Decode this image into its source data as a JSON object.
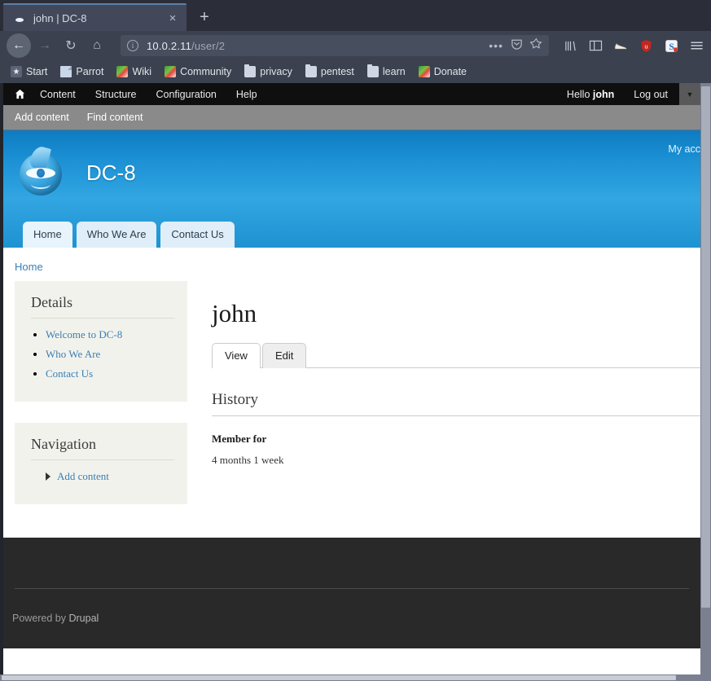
{
  "browser": {
    "tab": {
      "title": "john | DC-8",
      "favicon": "drupal-drop-icon",
      "close": "×"
    },
    "new_tab": "+",
    "nav": {
      "back": "←",
      "forward": "→",
      "reload": "↻",
      "home": "⌂"
    },
    "url": {
      "host": "10.0.2.11",
      "path": "/user/2",
      "info_icon": "ⓘ"
    },
    "url_actions": {
      "page_actions": "•••",
      "pocket": "✓",
      "bookmark_star": "☆"
    },
    "toolbar_icons": [
      {
        "name": "library-icon",
        "glyph": "▐▐∖"
      },
      {
        "name": "sidebar-icon",
        "glyph": "▤"
      },
      {
        "name": "shoe-extension-icon",
        "glyph": "👟"
      },
      {
        "name": "ublock-origin-icon",
        "glyph": "u"
      },
      {
        "name": "s-extension-icon",
        "glyph": "S"
      },
      {
        "name": "menu-icon",
        "glyph": "≡"
      }
    ],
    "bookmarks": [
      {
        "label": "Start",
        "icon": "star-icon"
      },
      {
        "label": "Parrot",
        "icon": "page-icon"
      },
      {
        "label": "Wiki",
        "icon": "parrot-icon"
      },
      {
        "label": "Community",
        "icon": "parrot-icon"
      },
      {
        "label": "privacy",
        "icon": "folder-icon"
      },
      {
        "label": "pentest",
        "icon": "folder-icon"
      },
      {
        "label": "learn",
        "icon": "folder-icon"
      },
      {
        "label": "Donate",
        "icon": "parrot-icon"
      }
    ]
  },
  "admin_toolbar": {
    "home_icon": "⌂",
    "items": [
      "Content",
      "Structure",
      "Configuration",
      "Help"
    ],
    "greeting_prefix": "Hello ",
    "username": "john",
    "logout": "Log out",
    "toggle_glyph": "▼",
    "sub_items": [
      "Add content",
      "Find content"
    ]
  },
  "site": {
    "name": "DC-8",
    "logo": "drupal-drop-logo",
    "my_account": "My acc",
    "nav_tabs": [
      {
        "label": "Home",
        "active": true
      },
      {
        "label": "Who We Are",
        "active": false
      },
      {
        "label": "Contact Us",
        "active": false
      }
    ]
  },
  "breadcrumb": {
    "home": "Home"
  },
  "sidebar": {
    "blocks": [
      {
        "title": "Details",
        "links": [
          "Welcome to DC-8",
          "Who We Are",
          "Contact Us"
        ]
      },
      {
        "title": "Navigation",
        "links": [
          "Add content"
        ]
      }
    ]
  },
  "main": {
    "title": "john",
    "tabs": [
      {
        "label": "View",
        "active": true
      },
      {
        "label": "Edit",
        "active": false
      }
    ],
    "section_title": "History",
    "field_label": "Member for",
    "field_value": "4 months 1 week"
  },
  "footer": {
    "powered_prefix": "Powered by ",
    "powered_link": "Drupal"
  },
  "colors": {
    "drupal_blue": "#1a8ed2",
    "link_blue": "#3a7fb5",
    "admin_black": "#0f0f0f",
    "sidebar_bg": "#f2f2ec",
    "footer_bg": "#292929"
  }
}
